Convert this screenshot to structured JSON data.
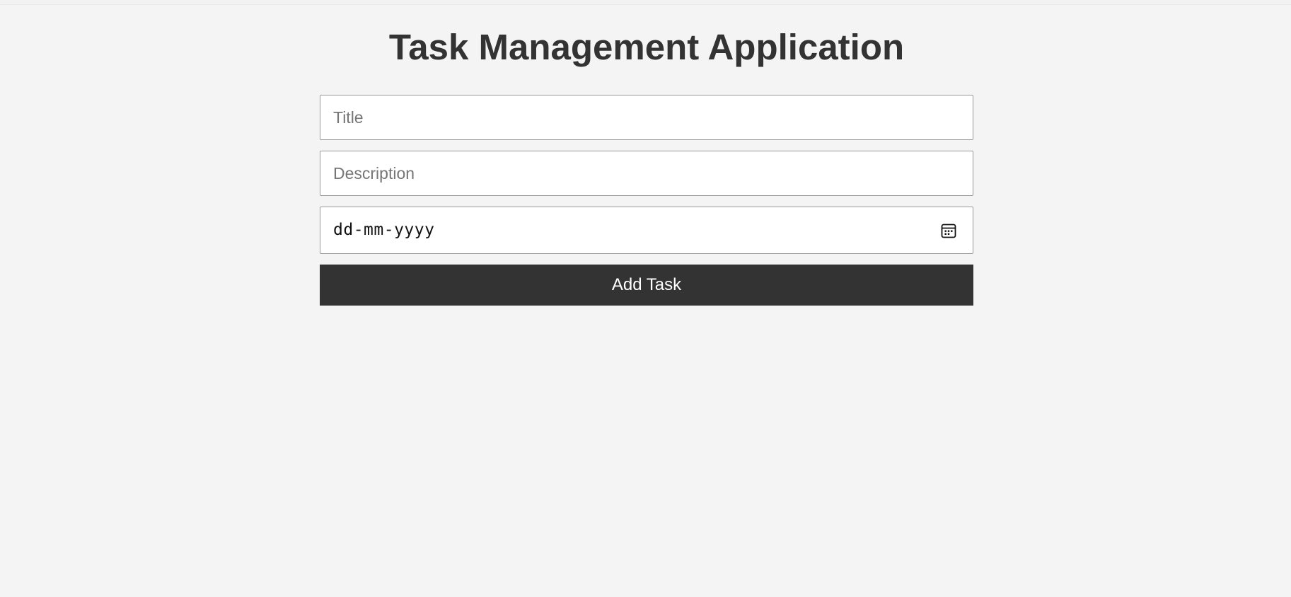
{
  "header": {
    "title": "Task Management Application"
  },
  "form": {
    "title_placeholder": "Title",
    "title_value": "",
    "description_placeholder": "Description",
    "description_value": "",
    "date_placeholder": "dd-mm-yyyy",
    "date_icon": "calendar-icon",
    "submit_label": "Add Task"
  },
  "colors": {
    "background": "#f4f4f4",
    "heading": "#333333",
    "button_bg": "#333333",
    "button_text": "#ffffff"
  }
}
